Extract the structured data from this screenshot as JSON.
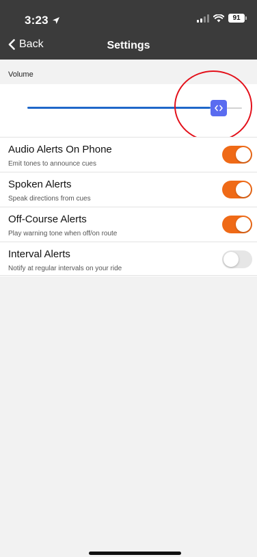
{
  "status_bar": {
    "time": "3:23",
    "battery": "91"
  },
  "nav": {
    "back_label": "Back",
    "title": "Settings"
  },
  "volume": {
    "label": "Volume",
    "level_fraction": 0.9
  },
  "rows": [
    {
      "title": "Audio Alerts On Phone",
      "subtitle": "Emit tones to announce cues",
      "enabled": true
    },
    {
      "title": "Spoken Alerts",
      "subtitle": "Speak directions from cues",
      "enabled": true
    },
    {
      "title": "Off-Course Alerts",
      "subtitle": "Play warning tone when off/on route",
      "enabled": true
    },
    {
      "title": "Interval Alerts",
      "subtitle": "Notify at regular intervals on your ride",
      "enabled": false
    }
  ],
  "colors": {
    "accent_orange": "#ef6a17",
    "slider_blue": "#1e67c9",
    "slider_thumb": "#5a6cf0",
    "annotation_red": "#e3101a"
  }
}
